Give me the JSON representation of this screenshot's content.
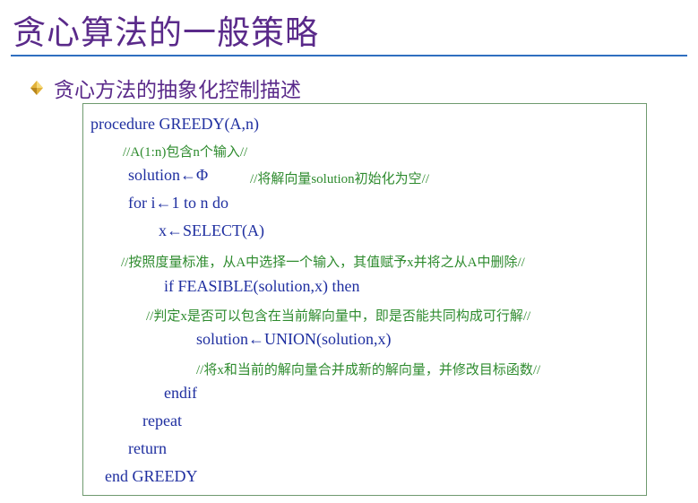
{
  "slide": {
    "title": "贪心算法的一般策略",
    "subtitle": "贪心方法的抽象化控制描述",
    "bullet_icon": "diamond-bullet-icon",
    "colors": {
      "title": "#5a2a8a",
      "rule": "#2f6fc0",
      "keyword": "#1f2fa0",
      "comment": "#2e8b2e",
      "box_border": "#6f9a6f"
    }
  },
  "code": {
    "line1": "procedure GREEDY(A,n)",
    "line2": "//A(1:n)包含n个输入//",
    "line3_code": "solution←Φ",
    "line3_comment": "//将解向量solution初始化为空//",
    "line4": "for i←1 to n do",
    "line5": "x←SELECT(A)",
    "line6": "//按照度量标准，从A中选择一个输入，其值赋予x并将之从A中删除//",
    "line7": "if FEASIBLE(solution,x)  then",
    "line8": "//判定x是否可以包含在当前解向量中，即是否能共同构成可行解//",
    "line9": "solution←UNION(solution,x)",
    "line10": "//将x和当前的解向量合并成新的解向量，并修改目标函数//",
    "line11": "endif",
    "line12": "repeat",
    "line13": "return",
    "line14": "end GREEDY"
  }
}
